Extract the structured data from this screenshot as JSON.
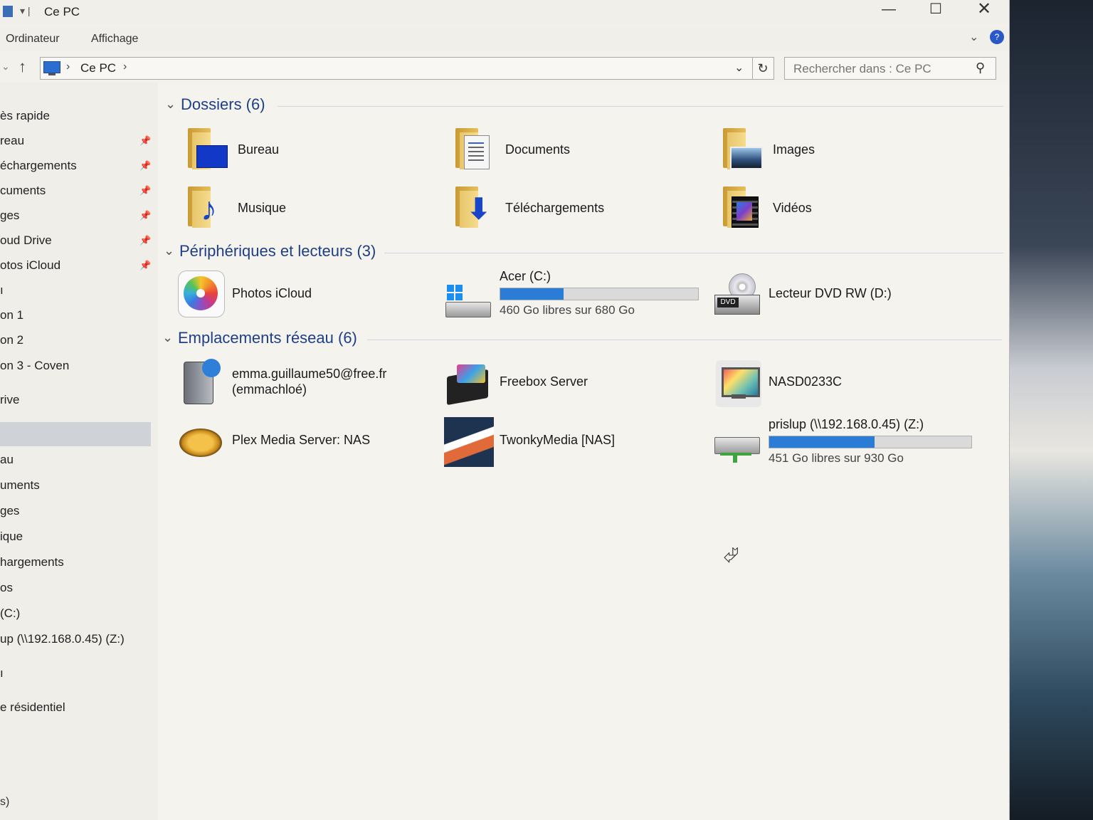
{
  "window": {
    "title": "Ce PC"
  },
  "ribbon": {
    "tabs": [
      "Ordinateur",
      "Affichage"
    ]
  },
  "address": {
    "crumbs": [
      "Ce PC"
    ]
  },
  "search": {
    "placeholder": "Rechercher dans : Ce PC"
  },
  "sidebar": {
    "items": [
      {
        "label": "ès rapide",
        "pinned": false
      },
      {
        "label": "reau",
        "pinned": true
      },
      {
        "label": "échargements",
        "pinned": true
      },
      {
        "label": "cuments",
        "pinned": true
      },
      {
        "label": "ges",
        "pinned": true
      },
      {
        "label": "oud Drive",
        "pinned": true
      },
      {
        "label": "otos iCloud",
        "pinned": true
      },
      {
        "label": "ı",
        "pinned": false
      },
      {
        "label": "on 1",
        "pinned": false
      },
      {
        "label": "on 2",
        "pinned": false
      },
      {
        "label": "on 3 - Coven",
        "pinned": false
      },
      {
        "label": "rive",
        "pinned": false
      },
      {
        "label": "",
        "pinned": false,
        "selected": true
      },
      {
        "label": "au",
        "pinned": false
      },
      {
        "label": "uments",
        "pinned": false
      },
      {
        "label": "ges",
        "pinned": false
      },
      {
        "label": "ique",
        "pinned": false
      },
      {
        "label": "hargements",
        "pinned": false
      },
      {
        "label": "os",
        "pinned": false
      },
      {
        "label": "(C:)",
        "pinned": false
      },
      {
        "label": "up (\\\\192.168.0.45) (Z:)",
        "pinned": false
      },
      {
        "label": "ı",
        "pinned": false
      },
      {
        "label": "e résidentiel",
        "pinned": false
      }
    ],
    "status": "s)"
  },
  "groups": {
    "folders": {
      "title": "Dossiers (6)",
      "items": [
        "Bureau",
        "Documents",
        "Images",
        "Musique",
        "Téléchargements",
        "Vidéos"
      ]
    },
    "devices": {
      "title": "Périphériques et lecteurs (3)",
      "photos": "Photos iCloud",
      "c_drive": {
        "label": "Acer (C:)",
        "free": "460 Go libres sur 680 Go",
        "used_fraction": 0.32
      },
      "dvd": "Lecteur DVD RW (D:)"
    },
    "network": {
      "title": "Emplacements réseau (6)",
      "emma_line1": "emma.guillaume50@free.fr",
      "emma_line2": "(emmachloé)",
      "freebox": "Freebox Server",
      "nasd": "NASD0233C",
      "plex": "Plex Media Server: NAS",
      "twonky": "TwonkyMedia [NAS]",
      "z_drive": {
        "label": "prislup (\\\\192.168.0.45) (Z:)",
        "free": "451 Go libres sur 930 Go",
        "used_fraction": 0.52
      }
    }
  },
  "colors": {
    "accent": "#1f3f85",
    "bar_fill": "#2a7dd6"
  }
}
